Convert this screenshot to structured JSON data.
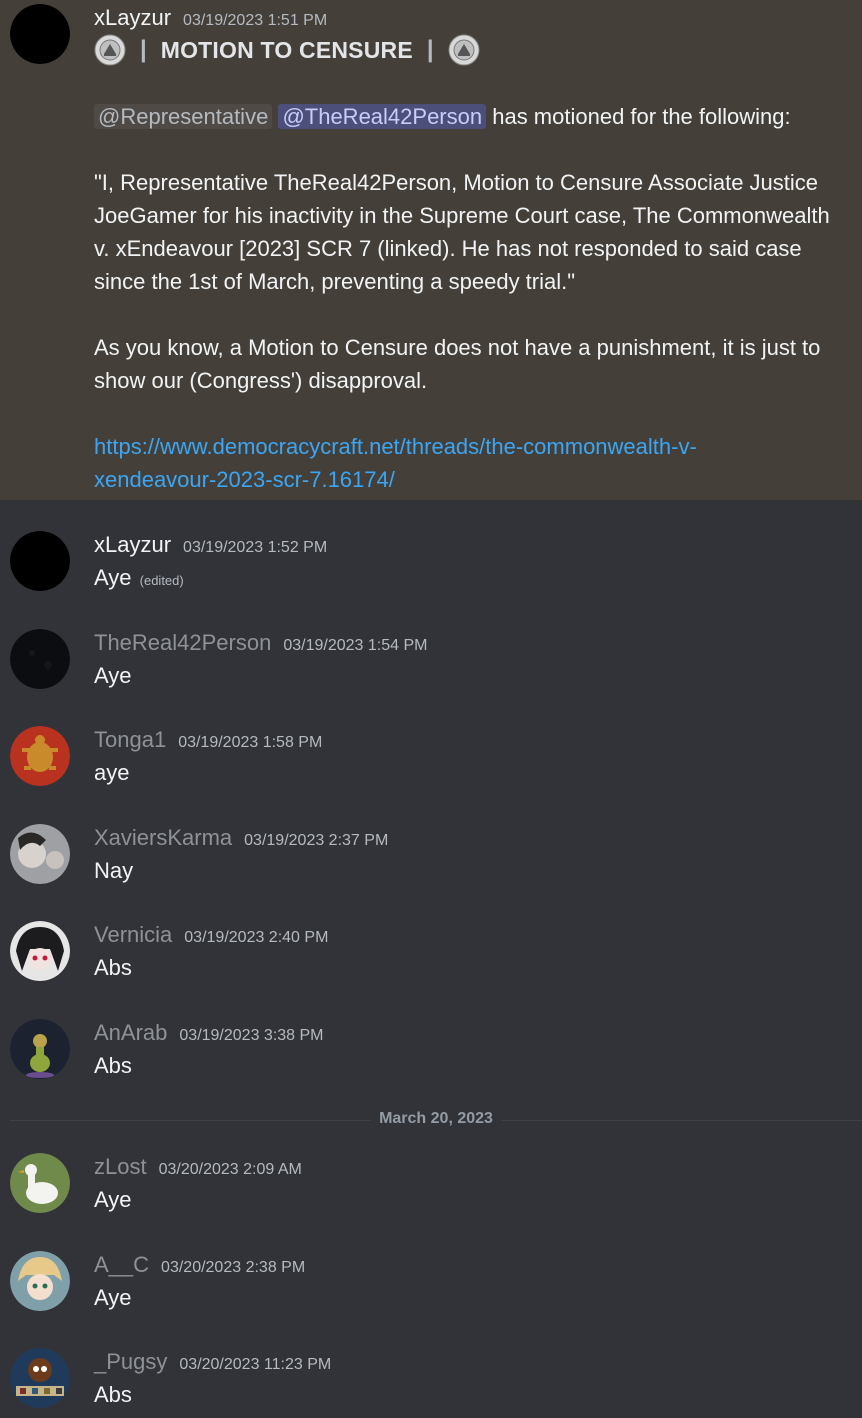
{
  "motion_message": {
    "username": "xLayzur",
    "timestamp": "03/19/2023 1:51 PM",
    "title": "MOTION TO CENSURE",
    "role_mention": "@Representative",
    "user_mention": "@TheReal42Person",
    "intro_suffix": " has motioned for the following:",
    "quote": "\"I, Representative TheReal42Person, Motion to Censure Associate Justice JoeGamer for his inactivity in the Supreme Court case, The Commonwealth v. xEndeavour [2023] SCR 7 (linked). He has not responded to said case since the 1st of March, preventing a speedy trial.\"",
    "note": "As you know, a Motion to Censure does not have a punishment, it is just to show our (Congress') disapproval.",
    "link_line1": "https://www.democracycraft.net/threads/the-commonwealth-v-",
    "link_line2": "xendeavour-2023-scr-7.16174/",
    "colors": {
      "highlight_bg": "#444039",
      "link": "#3ba6f5",
      "mention_user_bg": "#4b4f7a"
    }
  },
  "messages": [
    {
      "username": "xLayzur",
      "timestamp": "03/19/2023 1:52 PM",
      "content": "Aye",
      "edited": "(edited)",
      "avatar": "black-circle-avatar"
    },
    {
      "username": "TheReal42Person",
      "timestamp": "03/19/2023 1:54 PM",
      "content": "Aye",
      "avatar": "dark-texture-avatar"
    },
    {
      "username": "Tonga1",
      "timestamp": "03/19/2023 1:58 PM",
      "content": "aye",
      "avatar": "turtle-avatar"
    },
    {
      "username": "XaviersKarma",
      "timestamp": "03/19/2023 2:37 PM",
      "content": "Nay",
      "avatar": "portrait-avatar"
    },
    {
      "username": "Vernicia",
      "timestamp": "03/19/2023 2:40 PM",
      "content": "Abs",
      "avatar": "anime-avatar"
    },
    {
      "username": "AnArab",
      "timestamp": "03/19/2023 3:38 PM",
      "content": "Abs",
      "avatar": "bird-avatar"
    },
    {
      "username": "zLost",
      "timestamp": "03/20/2023 2:09 AM",
      "content": "Aye",
      "avatar": "goose-avatar"
    },
    {
      "username": "A__C",
      "timestamp": "03/20/2023 2:38 PM",
      "content": "Aye",
      "avatar": "anime-avatar-2"
    },
    {
      "username": "_Pugsy",
      "timestamp": "03/20/2023 11:23 PM",
      "content": "Abs",
      "avatar": "cartoon-avatar"
    }
  ],
  "date_divider": "March 20, 2023"
}
